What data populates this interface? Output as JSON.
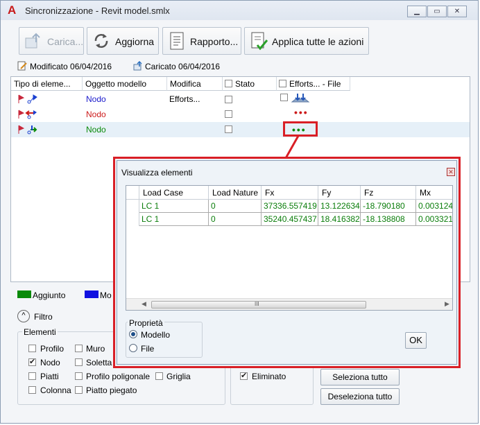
{
  "window": {
    "title": "Sincronizzazione - Revit model.smlx",
    "app_icon": "A"
  },
  "toolbar": {
    "load_label": "Carica...",
    "refresh_label": "Aggiorna",
    "report_label": "Rapporto...",
    "apply_all_label": "Applica tutte le azioni"
  },
  "info": {
    "modified": "Modificato 06/04/2016",
    "loaded": "Caricato 06/04/2016"
  },
  "grid": {
    "columns": [
      "Tipo di eleme...",
      "Oggetto modello",
      "Modifica",
      "Stato",
      "Efforts... - File"
    ],
    "rows": [
      {
        "object": "Nodo",
        "modification": "Efforts...",
        "color": "#1a1acc"
      },
      {
        "object": "Nodo",
        "modification": "",
        "color": "#cc1a1a"
      },
      {
        "object": "Nodo",
        "modification": "",
        "color": "#0a8a0a"
      }
    ]
  },
  "legend": {
    "added": {
      "label": "Aggiunto",
      "color": "#0a8a0a"
    },
    "modified": {
      "label": "Mo",
      "color": "#1010e0"
    }
  },
  "filter": {
    "title": "Filtro",
    "elements_title": "Elementi",
    "items": [
      {
        "label": "Profilo",
        "checked": false
      },
      {
        "label": "Muro",
        "checked": false
      },
      {
        "label": "Nodo",
        "checked": true
      },
      {
        "label": "Soletta",
        "checked": false
      },
      {
        "label": "Piatti",
        "checked": false
      },
      {
        "label": "Profilo poligonale",
        "checked": false
      },
      {
        "label": "Griglia",
        "checked": false
      },
      {
        "label": "Colonna",
        "checked": false
      },
      {
        "label": "Piatto piegato",
        "checked": false
      }
    ],
    "deleted_label": "Eliminato",
    "select_all": "Seleziona tutto",
    "deselect_all": "Deseleziona tutto"
  },
  "popup": {
    "title": "Visualizza elementi",
    "columns": [
      "Load Case",
      "Load Nature",
      "Fx",
      "Fy",
      "Fz",
      "Mx"
    ],
    "rows": [
      [
        "LC 1",
        "0",
        "37336.557419",
        "13.122634",
        "-18.790180",
        "0.003124"
      ],
      [
        "LC 1",
        "0",
        "35240.457437",
        "18.416382",
        "-18.138808",
        "0.003321"
      ]
    ],
    "scroll_grip": "III",
    "property_title": "Proprietà",
    "option_model": "Modello",
    "option_file": "File",
    "ok_label": "OK"
  }
}
